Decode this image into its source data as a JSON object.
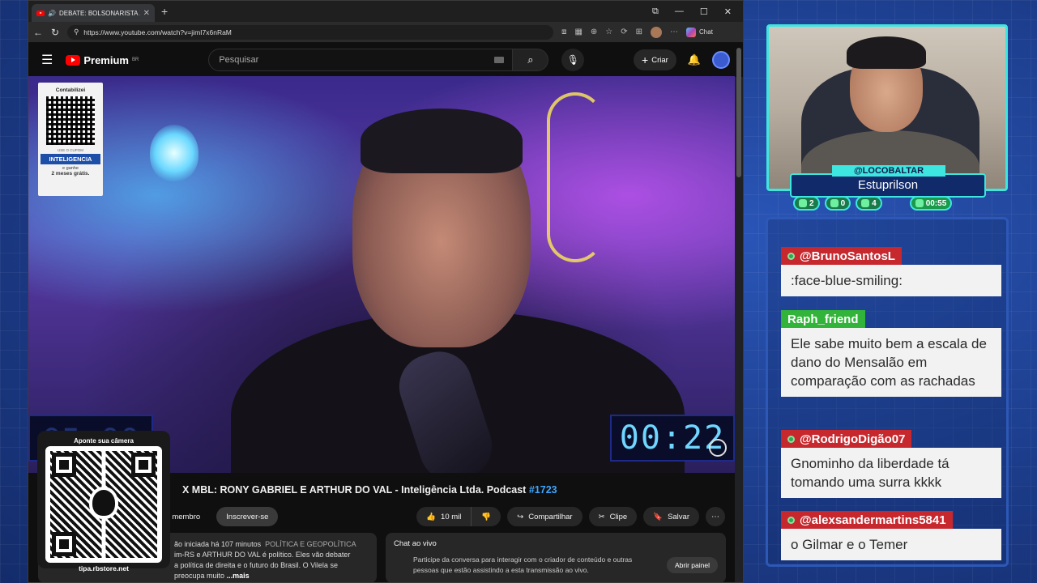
{
  "browser": {
    "tab_title": "DEBATE: BOLSONARISTA X MI",
    "url": "https://www.youtube.com/watch?v=jimI7x6nRaM",
    "chat_label": "Chat"
  },
  "youtube": {
    "logo": "Premium",
    "region": "BR",
    "search_placeholder": "Pesquisar",
    "create_label": "Criar"
  },
  "sponsor": {
    "brand": "Contabilizei",
    "use": "USE O CUPOM",
    "code": "INTELIGENCIA",
    "line1": "e ganhe",
    "line2": "2 meses grátis."
  },
  "overlay_timer": "00:22",
  "overlay_timer_left": "05:00",
  "video": {
    "title": "X MBL: RONY GABRIEL E ARTHUR DO VAL - Inteligência Ltda. Podcast",
    "tag": "#1723",
    "join_label": "eja membro",
    "subscribe_label": "Inscrever-se",
    "likes": "10 mil",
    "share_label": "Compartilhar",
    "clip_label": "Clipe",
    "save_label": "Salvar",
    "desc_line1": "ão iniciada há 107 minutos",
    "desc_category": "POLÍTICA E GEOPOLÍTICA",
    "desc_line2": "im-RS e ARTHUR DO VAL é político. Eles vão debater",
    "desc_line3": "a política de direita e o futuro do Brasil. O Vilela se preocupa muito",
    "desc_more": "...mais"
  },
  "live_chat": {
    "title": "Chat ao vivo",
    "text": "Participe da conversa para interagir com o criador de conteúdo e outras pessoas que estão assistindo a esta transmissão ao vivo.",
    "open_label": "Abrir painel"
  },
  "qr_card": {
    "hint": "Aponte sua câmera",
    "site": "tipa.rbstore.net"
  },
  "streamer": {
    "handle": "@LOCOBALTAR",
    "name": "Estuprilson",
    "stat1": "2",
    "stat2": "0",
    "stat3": "4",
    "timer": "00:55"
  },
  "chat_messages": [
    {
      "user": "@BrunoSantosL",
      "text": ":face-blue-smiling:",
      "color": "red"
    },
    {
      "user": "Raph_friend",
      "text": "Ele sabe muito bem a escala de dano do Mensalão em comparação com as rachadas",
      "color": "green"
    },
    {
      "user": "@RodrigoDigão07",
      "text": "Gnominho da liberdade tá tomando uma surra kkkk",
      "color": "red"
    },
    {
      "user": "@alexsandermartins5841",
      "text": "o Gilmar e o Temer",
      "color": "red"
    }
  ],
  "icons": [
    "youtube-icon",
    "speaker-icon",
    "close-icon",
    "back-icon",
    "refresh-icon",
    "menu-icon",
    "search-icon",
    "mic-icon",
    "plus-icon",
    "bell-icon",
    "like-icon",
    "dislike-icon",
    "share-icon",
    "scissors-icon",
    "bookmark-icon",
    "more-icon"
  ]
}
